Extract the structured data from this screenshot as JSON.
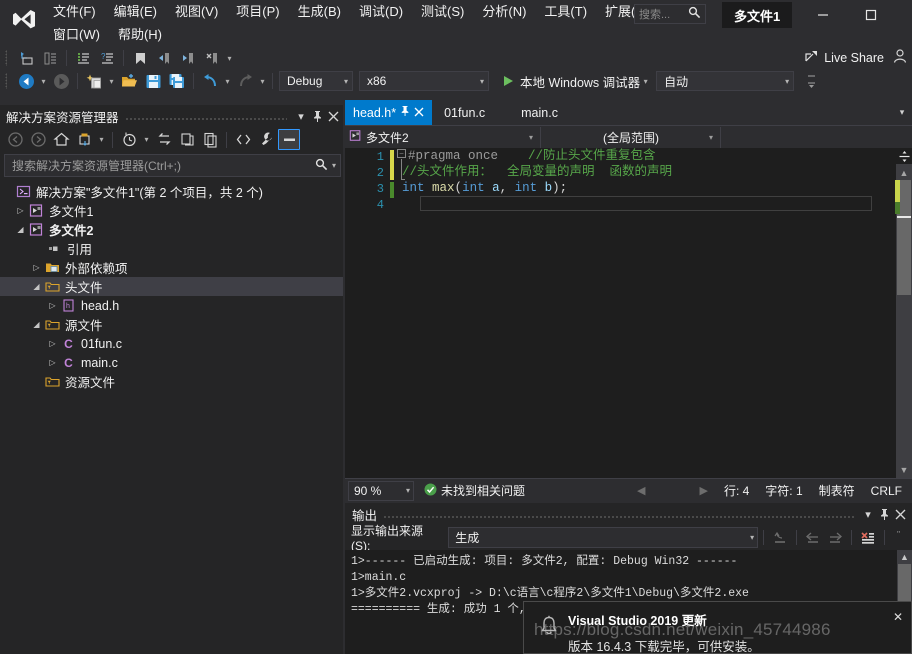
{
  "window": {
    "solution_badge": "多文件1",
    "minimize": "—",
    "maximize": "□"
  },
  "menu": {
    "row1": [
      {
        "label": "文件(F)",
        "name": "menu-file"
      },
      {
        "label": "编辑(E)",
        "name": "menu-edit"
      },
      {
        "label": "视图(V)",
        "name": "menu-view"
      },
      {
        "label": "项目(P)",
        "name": "menu-project"
      },
      {
        "label": "生成(B)",
        "name": "menu-build"
      },
      {
        "label": "调试(D)",
        "name": "menu-debug"
      },
      {
        "label": "测试(S)",
        "name": "menu-test"
      },
      {
        "label": "分析(N)",
        "name": "menu-analyze"
      },
      {
        "label": "工具(T)",
        "name": "menu-tools"
      },
      {
        "label": "扩展(X)",
        "name": "menu-extensions"
      }
    ],
    "row2": [
      {
        "label": "窗口(W)",
        "name": "menu-window"
      },
      {
        "label": "帮助(H)",
        "name": "menu-help"
      }
    ]
  },
  "quick_search": {
    "placeholder": "搜索...",
    "icon": "search-icon"
  },
  "toolbar": {
    "config": "Debug",
    "platform": "x86",
    "run_label": "本地 Windows 调试器",
    "auto": "自动",
    "live_share": "Live Share"
  },
  "solution_explorer": {
    "title": "解决方案资源管理器",
    "search_placeholder": "搜索解决方案资源管理器(Ctrl+;)",
    "tree": [
      {
        "label": "解决方案\"多文件1\"(第 2 个项目，共 2 个)",
        "indent": 0,
        "arrow": "",
        "icon": "solution-icon",
        "bold": false,
        "selected": false
      },
      {
        "label": "多文件1",
        "indent": 1,
        "arrow": "▷",
        "icon": "project-icon",
        "bold": false,
        "selected": false
      },
      {
        "label": "多文件2",
        "indent": 1,
        "arrow": "◢",
        "icon": "project-icon",
        "bold": true,
        "selected": false
      },
      {
        "label": "引用",
        "indent": 2,
        "arrow": "",
        "icon": "references-icon",
        "bold": false,
        "selected": false
      },
      {
        "label": "外部依赖项",
        "indent": 2,
        "arrow": "▷",
        "icon": "folder-icon",
        "bold": false,
        "selected": false
      },
      {
        "label": "头文件",
        "indent": 2,
        "arrow": "◢",
        "icon": "filter-folder-icon",
        "bold": false,
        "selected": true
      },
      {
        "label": "head.h",
        "indent": 3,
        "arrow": "▷",
        "icon": "header-file-icon",
        "bold": false,
        "selected": false
      },
      {
        "label": "源文件",
        "indent": 2,
        "arrow": "◢",
        "icon": "filter-folder-icon",
        "bold": false,
        "selected": false
      },
      {
        "label": "01fun.c",
        "indent": 3,
        "arrow": "▷",
        "icon": "c-file-icon",
        "bold": false,
        "selected": false
      },
      {
        "label": "main.c",
        "indent": 3,
        "arrow": "▷",
        "icon": "c-file-icon",
        "bold": false,
        "selected": false
      },
      {
        "label": "资源文件",
        "indent": 2,
        "arrow": "",
        "icon": "filter-folder-icon",
        "bold": false,
        "selected": false
      }
    ]
  },
  "editor": {
    "tabs": [
      {
        "label": "head.h*",
        "active": true
      },
      {
        "label": "01fun.c",
        "active": false
      },
      {
        "label": "main.c",
        "active": false
      }
    ],
    "nav_project": "多文件2",
    "nav_scope": "(全局范围)",
    "line_numbers": [
      "1",
      "2",
      "3",
      "4"
    ],
    "code": [
      {
        "segments": [
          {
            "t": "#pragma once",
            "c": "pp"
          },
          {
            "t": "    ",
            "c": "pun"
          },
          {
            "t": "//防止头文件重复包含",
            "c": "cm"
          }
        ]
      },
      {
        "segments": [
          {
            "t": "//头文件作用：  全局变量的声明  函数的声明",
            "c": "cm"
          }
        ]
      },
      {
        "segments": [
          {
            "t": "int",
            "c": "kw"
          },
          {
            "t": " ",
            "c": "pun"
          },
          {
            "t": "max",
            "c": "fn"
          },
          {
            "t": "(",
            "c": "pun"
          },
          {
            "t": "int",
            "c": "kw"
          },
          {
            "t": " ",
            "c": "pun"
          },
          {
            "t": "a",
            "c": "id"
          },
          {
            "t": ", ",
            "c": "pun"
          },
          {
            "t": "int",
            "c": "kw"
          },
          {
            "t": " ",
            "c": "pun"
          },
          {
            "t": "b",
            "c": "id"
          },
          {
            "t": ");",
            "c": "pun"
          }
        ]
      },
      {
        "segments": []
      }
    ],
    "status": {
      "zoom": "90 %",
      "issues": "未找到相关问题",
      "line": "行: 4",
      "col": "字符: 1",
      "tabs_mode": "制表符",
      "eol": "CRLF"
    }
  },
  "output": {
    "title": "输出",
    "source_label": "显示输出来源(S):",
    "source_value": "生成",
    "lines": [
      "1>------ 已启动生成: 项目: 多文件2, 配置: Debug Win32 ------",
      "1>main.c",
      "1>多文件2.vcxproj -> D:\\c语言\\c程序2\\多文件1\\Debug\\多文件2.exe",
      "========== 生成: 成功 1 个,"
    ]
  },
  "toast": {
    "title": "Visual Studio 2019 更新",
    "body": "版本 16.4.3 下载完毕，可供安装。",
    "close": "✕",
    "icon": "bell-icon"
  },
  "watermark": "https://blog.csdn.net/weixin_45744986",
  "colors": {
    "accent": "#007acc",
    "chrome": "#2d2d30",
    "panel": "#252526",
    "editor_bg": "#1e1e1e",
    "comment": "#57a64a",
    "keyword": "#569cd6",
    "linenum": "#2b91af"
  }
}
